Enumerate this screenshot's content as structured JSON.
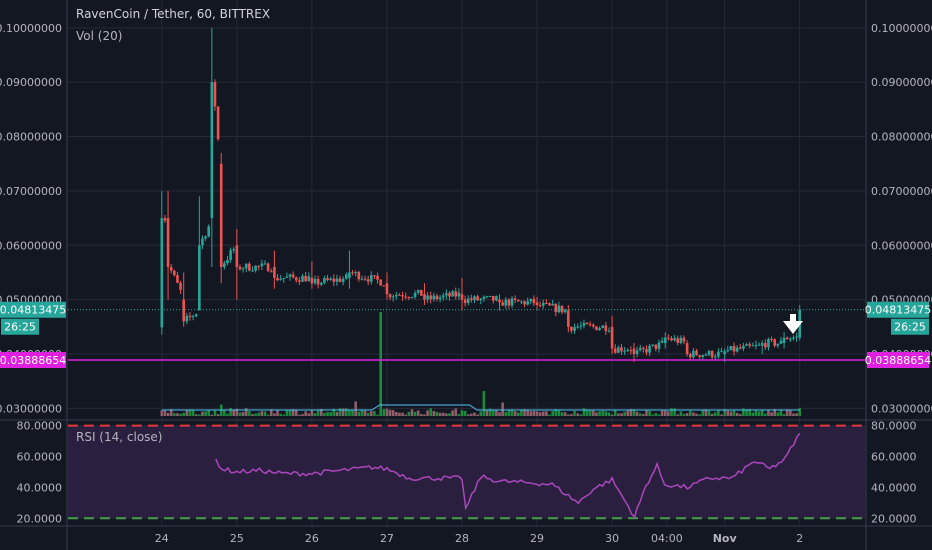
{
  "header": {
    "title": "RavenCoin / Tether, 60, BITTREX",
    "volume_label": "Vol (20)"
  },
  "price_axis": {
    "ticks": [
      "0.10000000",
      "0.09000000",
      "0.08000000",
      "0.07000000",
      "0.06000000",
      "0.05000000",
      "0.04000000",
      "0.03000000"
    ],
    "tick_values": [
      0.1,
      0.09,
      0.08,
      0.07,
      0.06,
      0.05,
      0.04,
      0.03
    ],
    "range": [
      0.02785,
      0.10365
    ]
  },
  "badges": {
    "last_price": "0.04813475",
    "countdown": "26:25",
    "level_price": "0.03888654"
  },
  "levels": {
    "last_price_value": 0.04813475,
    "level_value": 0.03888654
  },
  "rsi": {
    "label": "RSI (14, close)",
    "ticks": [
      "80.0000",
      "60.0000",
      "40.0000",
      "20.0000"
    ],
    "tick_values": [
      80,
      60,
      40,
      20
    ],
    "range": [
      15,
      83
    ],
    "upper_band": 80,
    "lower_band": 20
  },
  "time_axis": {
    "labels": [
      "24",
      "25",
      "26",
      "27",
      "28",
      "29",
      "30",
      "04:00",
      "Nov",
      "2"
    ],
    "positions": [
      0.0,
      1.0,
      2.0,
      3.0,
      4.0,
      5.0,
      6.0,
      6.73,
      7.5,
      8.5
    ]
  },
  "colors": {
    "background": "#131722",
    "grid": "#242a36",
    "text": "#b2b5be",
    "up": "#26a69a",
    "down": "#ef5350",
    "vol_up": "#1b8a3c",
    "vol_down": "#8e5f69",
    "level": "#e020e0",
    "rsi_line": "#ab47bc",
    "rsi_band": "#2a1f3e",
    "band_upper": "#e53935",
    "band_lower": "#43a047",
    "badge": "#26a69a"
  },
  "icons": {
    "marker": "arrow-down-icon"
  },
  "chart_data": {
    "type": "candlestick",
    "x_unit": "day offset from Oct 24 (hourly candles)",
    "series": [
      {
        "name": "RavenCoin / Tether",
        "ohlc_keypoints": [
          {
            "t": 0.0,
            "o": 0.0449,
            "h": 0.07,
            "l": 0.0435,
            "c": 0.065
          },
          {
            "t": 0.1,
            "o": 0.065,
            "h": 0.07,
            "l": 0.05,
            "c": 0.056
          },
          {
            "t": 0.3,
            "o": 0.05,
            "h": 0.055,
            "l": 0.045,
            "c": 0.046
          },
          {
            "t": 0.5,
            "o": 0.048,
            "h": 0.069,
            "l": 0.048,
            "c": 0.06
          },
          {
            "t": 0.68,
            "o": 0.065,
            "h": 0.1,
            "l": 0.056,
            "c": 0.09
          },
          {
            "t": 0.78,
            "o": 0.075,
            "h": 0.077,
            "l": 0.053,
            "c": 0.056
          },
          {
            "t": 1.0,
            "o": 0.06,
            "h": 0.063,
            "l": 0.05,
            "c": 0.056
          },
          {
            "t": 1.5,
            "o": 0.056,
            "h": 0.059,
            "l": 0.052,
            "c": 0.054
          },
          {
            "t": 2.0,
            "o": 0.054,
            "h": 0.057,
            "l": 0.052,
            "c": 0.053
          },
          {
            "t": 2.5,
            "o": 0.054,
            "h": 0.059,
            "l": 0.052,
            "c": 0.055
          },
          {
            "t": 3.0,
            "o": 0.053,
            "h": 0.055,
            "l": 0.05,
            "c": 0.051
          },
          {
            "t": 3.5,
            "o": 0.051,
            "h": 0.053,
            "l": 0.049,
            "c": 0.05
          },
          {
            "t": 4.0,
            "o": 0.051,
            "h": 0.054,
            "l": 0.048,
            "c": 0.05
          },
          {
            "t": 4.5,
            "o": 0.05,
            "h": 0.051,
            "l": 0.048,
            "c": 0.0495
          },
          {
            "t": 5.0,
            "o": 0.0495,
            "h": 0.0505,
            "l": 0.048,
            "c": 0.049
          },
          {
            "t": 5.4,
            "o": 0.048,
            "h": 0.049,
            "l": 0.044,
            "c": 0.045
          },
          {
            "t": 6.0,
            "o": 0.045,
            "h": 0.047,
            "l": 0.04,
            "c": 0.041
          },
          {
            "t": 6.3,
            "o": 0.041,
            "h": 0.042,
            "l": 0.0385,
            "c": 0.04
          },
          {
            "t": 6.7,
            "o": 0.042,
            "h": 0.044,
            "l": 0.041,
            "c": 0.043
          },
          {
            "t": 7.0,
            "o": 0.042,
            "h": 0.0425,
            "l": 0.0395,
            "c": 0.04
          },
          {
            "t": 7.5,
            "o": 0.04,
            "h": 0.041,
            "l": 0.0385,
            "c": 0.0405
          },
          {
            "t": 8.0,
            "o": 0.0415,
            "h": 0.0425,
            "l": 0.04,
            "c": 0.042
          },
          {
            "t": 8.3,
            "o": 0.042,
            "h": 0.044,
            "l": 0.041,
            "c": 0.043
          },
          {
            "t": 8.5,
            "o": 0.043,
            "h": 0.049,
            "l": 0.0425,
            "c": 0.0481
          }
        ]
      }
    ],
    "volume": {
      "name": "Vol (20)",
      "spikes": [
        {
          "t": 2.9,
          "value": 1.0
        },
        {
          "t": 4.3,
          "value": 0.24
        },
        {
          "t": 2.6,
          "value": 0.14
        },
        {
          "t": 4.55,
          "value": 0.13
        },
        {
          "t": 0.8,
          "value": 0.11
        }
      ],
      "baseline": 0.04
    },
    "rsi_series": {
      "name": "RSI (14, close)",
      "points": [
        [
          0.72,
          58
        ],
        [
          0.8,
          52
        ],
        [
          1.0,
          50
        ],
        [
          1.3,
          51
        ],
        [
          1.6,
          49
        ],
        [
          2.0,
          49
        ],
        [
          2.4,
          51
        ],
        [
          2.8,
          53
        ],
        [
          3.0,
          52
        ],
        [
          3.3,
          46
        ],
        [
          3.6,
          46
        ],
        [
          4.0,
          46
        ],
        [
          4.05,
          26
        ],
        [
          4.25,
          47
        ],
        [
          4.5,
          44
        ],
        [
          4.9,
          43
        ],
        [
          5.2,
          42
        ],
        [
          5.55,
          30
        ],
        [
          5.75,
          39
        ],
        [
          6.0,
          45
        ],
        [
          6.3,
          21
        ],
        [
          6.45,
          41
        ],
        [
          6.6,
          54
        ],
        [
          6.7,
          42
        ],
        [
          7.0,
          40
        ],
        [
          7.3,
          46
        ],
        [
          7.6,
          46
        ],
        [
          7.9,
          57
        ],
        [
          8.1,
          52
        ],
        [
          8.3,
          58
        ],
        [
          8.5,
          75
        ]
      ]
    },
    "xlim": [
      -1.25,
      9.37
    ],
    "grid": true,
    "legend": "top-left"
  }
}
